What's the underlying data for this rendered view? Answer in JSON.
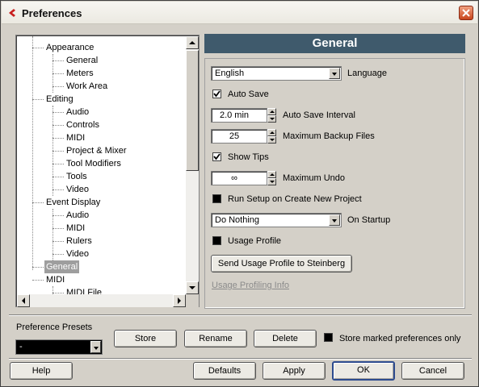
{
  "window": {
    "title": "Preferences",
    "accent": "#3f5a6c"
  },
  "tree": {
    "rows": [
      {
        "label": "Appearance",
        "level": 1
      },
      {
        "label": "General",
        "level": 2
      },
      {
        "label": "Meters",
        "level": 2
      },
      {
        "label": "Work Area",
        "level": 2
      },
      {
        "label": "Editing",
        "level": 1
      },
      {
        "label": "Audio",
        "level": 2
      },
      {
        "label": "Controls",
        "level": 2
      },
      {
        "label": "MIDI",
        "level": 2
      },
      {
        "label": "Project & Mixer",
        "level": 2
      },
      {
        "label": "Tool Modifiers",
        "level": 2
      },
      {
        "label": "Tools",
        "level": 2
      },
      {
        "label": "Video",
        "level": 2
      },
      {
        "label": "Event Display",
        "level": 1
      },
      {
        "label": "Audio",
        "level": 2
      },
      {
        "label": "MIDI",
        "level": 2
      },
      {
        "label": "Rulers",
        "level": 2
      },
      {
        "label": "Video",
        "level": 2
      },
      {
        "label": "General",
        "level": 1,
        "selected": true
      },
      {
        "label": "MIDI",
        "level": 1
      },
      {
        "label": "MIDI File",
        "level": 2
      }
    ]
  },
  "panel": {
    "header": "General",
    "language_value": "English",
    "language_label": "Language",
    "auto_save_label": "Auto Save",
    "auto_save_checked": true,
    "auto_save_interval_value": "2.0 min",
    "auto_save_interval_label": "Auto Save Interval",
    "max_backup_value": "25",
    "max_backup_label": "Maximum Backup Files",
    "show_tips_label": "Show Tips",
    "show_tips_checked": true,
    "max_undo_value": "∞",
    "max_undo_label": "Maximum Undo",
    "run_setup_label": "Run Setup on Create New Project",
    "run_setup_checked": false,
    "on_startup_value": "Do Nothing",
    "on_startup_label": "On Startup",
    "usage_profile_label": "Usage Profile",
    "usage_profile_checked": false,
    "send_usage_button": "Send Usage Profile to Steinberg",
    "usage_info_link": "Usage Profiling Info"
  },
  "presets": {
    "label": "Preference Presets",
    "selected": "-",
    "store_button": "Store",
    "rename_button": "Rename",
    "delete_button": "Delete",
    "store_marked_label": "Store marked preferences only",
    "store_marked_checked": false
  },
  "footer": {
    "help_button": "Help",
    "defaults_button": "Defaults",
    "apply_button": "Apply",
    "ok_button": "OK",
    "cancel_button": "Cancel"
  }
}
